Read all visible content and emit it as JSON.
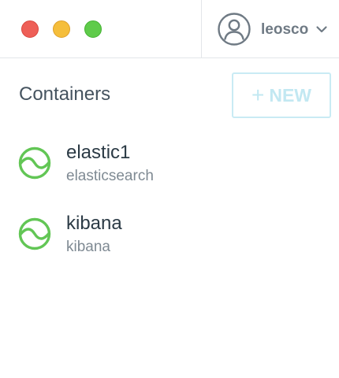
{
  "header": {
    "user": {
      "username": "leosco",
      "avatar_icon": "user-circle-icon",
      "dropdown_icon": "chevron-down-icon"
    }
  },
  "window_controls": {
    "close_color": "#ee5f57",
    "minimize_color": "#f5be3b",
    "maximize_color": "#5fcb4a"
  },
  "containers": {
    "title": "Containers",
    "new_button": {
      "icon": "plus-icon",
      "label": "NEW"
    },
    "items": [
      {
        "name": "elastic1",
        "image": "elasticsearch",
        "status_icon": "running-status-icon",
        "status_color": "#62c655"
      },
      {
        "name": "kibana",
        "image": "kibana",
        "status_icon": "running-status-icon",
        "status_color": "#62c655"
      }
    ]
  }
}
